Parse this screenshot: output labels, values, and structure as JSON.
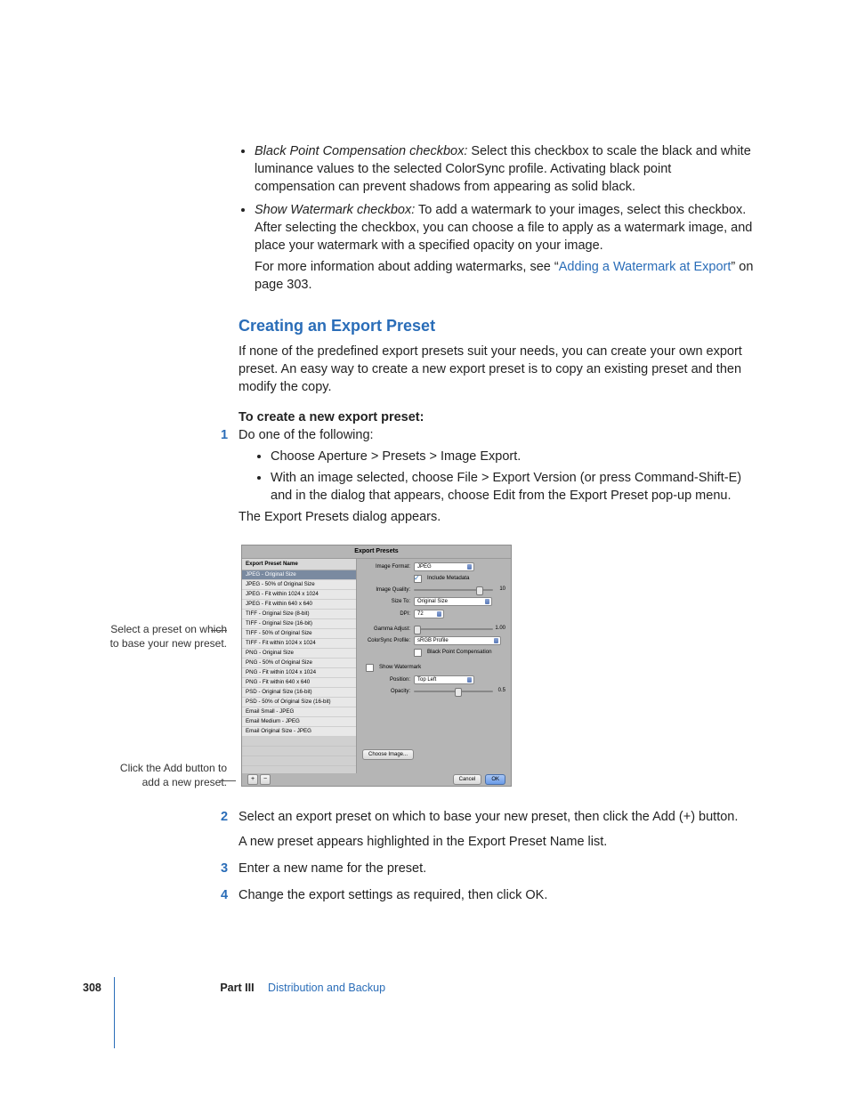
{
  "bullets_top": [
    {
      "label": "Black Point Compensation checkbox:",
      "text": "Select this checkbox to scale the black and white luminance values to the selected ColorSync profile. Activating black point compensation can prevent shadows from appearing as solid black."
    },
    {
      "label": "Show Watermark checkbox:",
      "text": "To add a watermark to your images, select this checkbox. After selecting the checkbox, you can choose a file to apply as a watermark image, and place your watermark with a specified opacity on your image.",
      "more_pre": "For more information about adding watermarks, see “",
      "more_link": "Adding a Watermark at Export",
      "more_post": "” on page 303."
    }
  ],
  "section_heading": "Creating an Export Preset",
  "section_intro": "If none of the predefined export presets suit your needs, you can create your own export preset. An easy way to create a new export preset is to copy an existing preset and then modify the copy.",
  "task_heading": "To create a new export preset:",
  "step1": {
    "text": "Do one of the following:",
    "subs": [
      "Choose Aperture > Presets > Image Export.",
      "With an image selected, choose File > Export Version (or press Command-Shift-E) and in the dialog that appears, choose Edit from the Export Preset pop-up menu."
    ],
    "after": "The Export Presets dialog appears."
  },
  "callouts": {
    "select": "Select a preset on which\nto base your new preset.",
    "add": "Click the Add button to\nadd a new preset."
  },
  "dialog": {
    "title": "Export Presets",
    "preset_header": "Export Preset Name",
    "presets": [
      "JPEG - Original Size",
      "JPEG - 50% of Original Size",
      "JPEG - Fit within 1024 x 1024",
      "JPEG - Fit within 640 x 640",
      "TIFF - Original Size (8-bit)",
      "TIFF - Original Size (16-bit)",
      "TIFF - 50% of Original Size",
      "TIFF - Fit within 1024 x 1024",
      "PNG - Original Size",
      "PNG - 50% of Original Size",
      "PNG - Fit within 1024 x 1024",
      "PNG - Fit within 640 x 640",
      "PSD - Original Size (16-bit)",
      "PSD - 50% of Original Size (16-bit)",
      "Email Small - JPEG",
      "Email Medium - JPEG",
      "Email Original Size - JPEG"
    ],
    "labels": {
      "image_format": "Image Format:",
      "include_metadata": "Include Metadata",
      "image_quality": "Image Quality:",
      "size_to": "Size To:",
      "dpi": "DPI:",
      "gamma": "Gamma Adjust:",
      "profile": "ColorSync Profile:",
      "bpc": "Black Point Compensation",
      "show_wm": "Show Watermark",
      "position": "Position:",
      "opacity": "Opacity:",
      "choose_image": "Choose Image...",
      "cancel": "Cancel",
      "ok": "OK",
      "add": "+",
      "remove": "−"
    },
    "values": {
      "image_format": "JPEG",
      "quality_val": "10",
      "size_to": "Original Size",
      "dpi": "72",
      "gamma_val": "1.00",
      "profile": "sRGB Profile",
      "position": "Top Left",
      "opacity_val": "0.5"
    }
  },
  "steps_after": [
    {
      "n": "2",
      "text_a": "Select an export preset on which to base your new preset, then click the Add (+) button.",
      "text_b": "A new preset appears highlighted in the Export Preset Name list."
    },
    {
      "n": "3",
      "text_a": "Enter a new name for the preset."
    },
    {
      "n": "4",
      "text_a": "Change the export settings as required, then click OK."
    }
  ],
  "footer": {
    "page": "308",
    "part": "Part III",
    "section": "Distribution and Backup"
  }
}
